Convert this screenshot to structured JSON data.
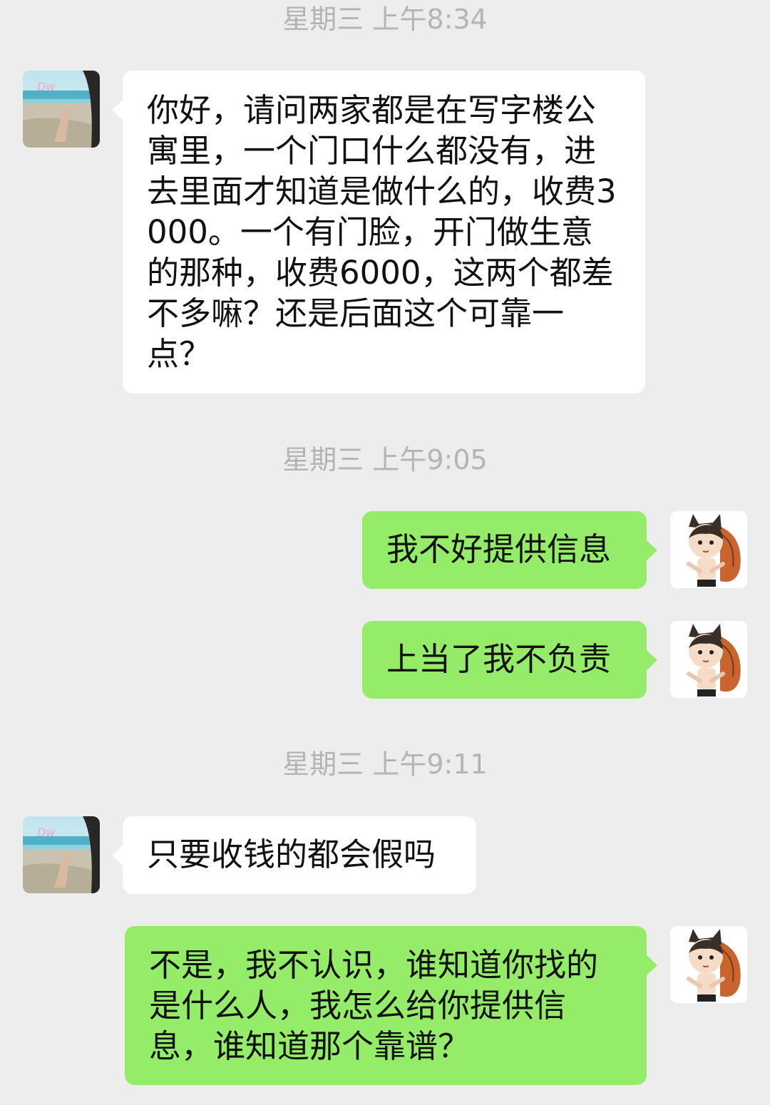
{
  "messages": [
    {
      "type": "time",
      "text": "星期三 上午8:34"
    },
    {
      "type": "msg",
      "side": "in",
      "text": "你好，请问两家都是在写字楼公寓里，一个门口什么都没有，进去里面才知道是做什么的，收费3000。一个有门脸，开门做生意的那种，收费6000，这两个都差不多嘛？还是后面这个可靠一点？"
    },
    {
      "type": "time",
      "text": "星期三 上午9:05"
    },
    {
      "type": "msg",
      "side": "out",
      "text": "我不好提供信息"
    },
    {
      "type": "msg",
      "side": "out",
      "text": "上当了我不负责"
    },
    {
      "type": "time",
      "text": "星期三 上午9:11"
    },
    {
      "type": "msg",
      "side": "in",
      "text": "只要收钱的都会假吗"
    },
    {
      "type": "msg",
      "side": "out",
      "text": "不是，我不认识，谁知道你找的是什么人，我怎么给你提供信息，谁知道那个靠谱？"
    }
  ],
  "colors": {
    "background": "#ededed",
    "bubble_in": "#ffffff",
    "bubble_out": "#95ec69",
    "timestamp": "#b4b4b4"
  },
  "avatars": {
    "contact": "beach-photo-avatar",
    "self": "cartoon-boy-avatar"
  }
}
